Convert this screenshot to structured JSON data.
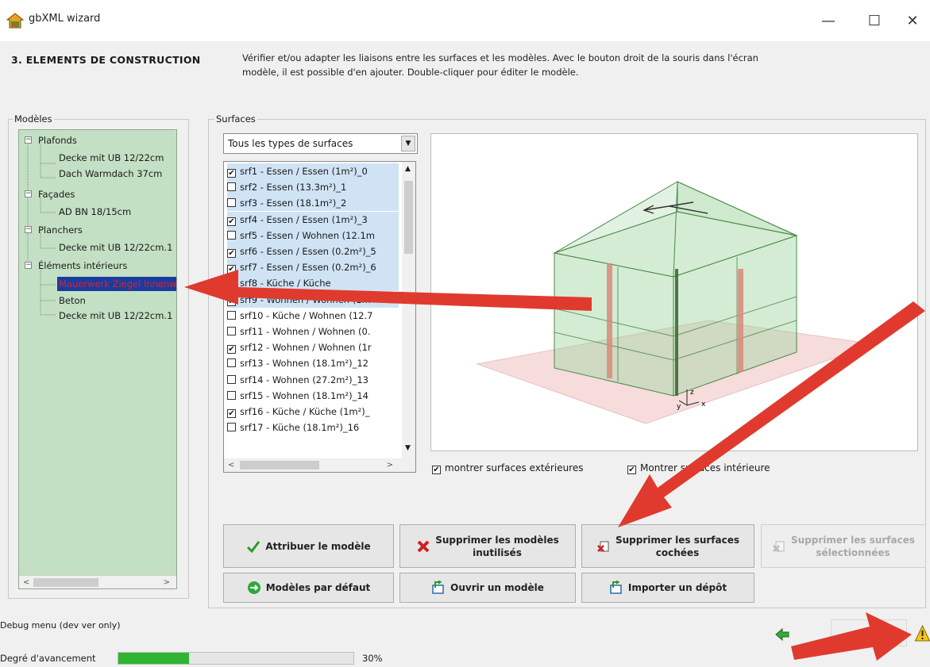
{
  "window": {
    "title": "gbXML wizard",
    "minimize": "—",
    "maximize": "☐",
    "close": "✕"
  },
  "header": {
    "step": "3.  ELEMENTS DE CONSTRUCTION",
    "description_line1": "Vérifier et/ou adapter les liaisons entre les surfaces et les modèles. Avec le bouton droit de la souris dans l'écran",
    "description_line2": "modèle, il est possible d'en ajouter. Double-cliquer pour éditer le modèle."
  },
  "models": {
    "label": "Modèles",
    "tree": [
      {
        "label": "Plafonds",
        "children": [
          "Decke mit UB 12/22cm",
          "Dach Warmdach 37cm"
        ]
      },
      {
        "label": "Façades",
        "children": [
          "AD BN 18/15cm"
        ]
      },
      {
        "label": "Planchers",
        "children": [
          "Decke mit UB 12/22cm.1"
        ]
      },
      {
        "label": "Éléments intérieurs",
        "children": [
          "Mauerwerk Ziegel Innenwand",
          "Beton",
          "Decke mit UB 12/22cm.1"
        ]
      }
    ],
    "expander": "−"
  },
  "surfaces": {
    "label": "Surfaces",
    "filter_value": "Tous les types de surfaces",
    "items": [
      {
        "label": "srf1 - Essen / Essen (1m²)_0",
        "checked": true,
        "highlight": true
      },
      {
        "label": "srf2 - Essen (13.3m²)_1",
        "checked": false,
        "highlight": true
      },
      {
        "label": "srf3 - Essen (18.1m²)_2",
        "checked": false,
        "highlight": true
      },
      {
        "label": "srf4 - Essen / Essen (1m²)_3",
        "checked": true,
        "highlight": true
      },
      {
        "label": "srf5 - Essen / Wohnen (12.1m",
        "checked": false,
        "highlight": true
      },
      {
        "label": "srf6 - Essen / Essen (0.2m²)_5",
        "checked": true,
        "highlight": true
      },
      {
        "label": "srf7 - Essen / Essen (0.2m²)_6",
        "checked": true,
        "highlight": true
      },
      {
        "label": "srf8 - Küche / Küche",
        "checked": false,
        "highlight": true
      },
      {
        "label": "srf9 - Wohnen / Wohnen (1m",
        "checked": true,
        "highlight": true
      },
      {
        "label": "srf10 - Küche / Wohnen (12.7",
        "checked": false,
        "highlight": false
      },
      {
        "label": "srf11 - Wohnen / Wohnen (0.",
        "checked": false,
        "highlight": false
      },
      {
        "label": "srf12 - Wohnen / Wohnen (1r",
        "checked": true,
        "highlight": false
      },
      {
        "label": "srf13 - Wohnen (18.1m²)_12",
        "checked": false,
        "highlight": false
      },
      {
        "label": "srf14 - Wohnen (27.2m²)_13",
        "checked": false,
        "highlight": false
      },
      {
        "label": "srf15 - Wohnen (18.1m²)_14",
        "checked": false,
        "highlight": false
      },
      {
        "label": "srf16 - Küche / Küche (1m²)_",
        "checked": true,
        "highlight": false
      },
      {
        "label": "srf17 - Küche (18.1m²)_16",
        "checked": false,
        "highlight": false
      }
    ],
    "show_exterior": "montrer surfaces extérieures",
    "show_interior": "Montrer surfaces intérieure",
    "check_mark": "✔"
  },
  "buttons": {
    "assign": "Attribuer le modèle",
    "delete_unused_line1": "Supprimer les modèles",
    "delete_unused_line2": "inutilisés",
    "delete_checked_line1": "Supprimer les surfaces",
    "delete_checked_line2": "cochées",
    "delete_selected_line1": "Supprimer les surfaces",
    "delete_selected_line2": "sélectionnées",
    "default_models": "Modèles par défaut",
    "open_model": "Ouvrir un modèle",
    "import_depot": "Importer un dépôt"
  },
  "footer": {
    "debug": "Debug menu (dev ver only)",
    "progress_label": "Degré d'avancement",
    "progress_value": 0.3,
    "progress_text": "30%"
  },
  "viewer_axes": {
    "x": "x",
    "y": "y",
    "z": "z"
  },
  "colors": {
    "tree_bg": "#c4e0c4",
    "list_highlight": "#cfe3f5",
    "progress": "#2fb52f",
    "arrow": "#e03a2e",
    "disabled_text": "#a8a8a8"
  }
}
